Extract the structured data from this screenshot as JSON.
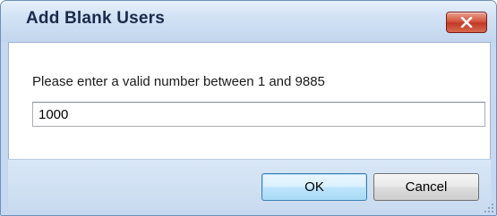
{
  "dialog": {
    "title": "Add Blank Users",
    "prompt": "Please enter a valid number between 1 and 9885",
    "input_value": "1000",
    "ok_label": "OK",
    "cancel_label": "Cancel"
  },
  "icons": {
    "close": "close-icon",
    "resize": "resize-grip-icon"
  },
  "colors": {
    "frame": "#c6d9f1",
    "close_button": "#c23a26",
    "ok_button_border": "#3c7fb1"
  }
}
